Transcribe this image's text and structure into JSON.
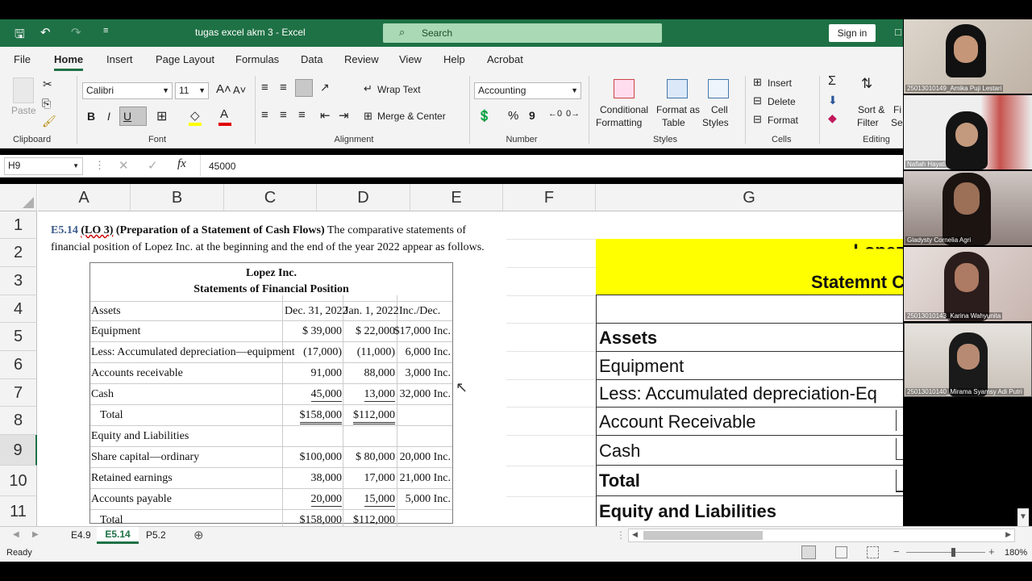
{
  "titlebar": {
    "filename": "tugas excel akm 3  -  Excel",
    "search_placeholder": "Search",
    "sign_in": "Sign in"
  },
  "menu": [
    "File",
    "Home",
    "Insert",
    "Page Layout",
    "Formulas",
    "Data",
    "Review",
    "View",
    "Help",
    "Acrobat"
  ],
  "ribbon": {
    "clipboard": {
      "paste": "Paste",
      "group": "Clipboard"
    },
    "font": {
      "name": "Calibri",
      "size": "11",
      "bold": "B",
      "italic": "I",
      "underline": "U",
      "group": "Font"
    },
    "alignment": {
      "wrap_text": "Wrap Text",
      "merge_center": "Merge & Center",
      "group": "Alignment"
    },
    "number": {
      "format": "Accounting",
      "percent": "%",
      "comma": "9",
      "group": "Number"
    },
    "styles": {
      "conditional": "Conditional",
      "formatting": "Formatting",
      "format_as": "Format as",
      "table": "Table",
      "cell": "Cell",
      "cell_styles": "Styles",
      "group": "Styles"
    },
    "cells": {
      "insert": "Insert",
      "delete": "Delete",
      "format": "Format",
      "group": "Cells"
    },
    "editing": {
      "sort": "Sort &",
      "filter": "Filter",
      "find": "Fi",
      "select": "Sel",
      "group": "Editing"
    }
  },
  "formula_bar": {
    "name_box": "H9",
    "fx": "fx",
    "value": "45000"
  },
  "columns": [
    "A",
    "B",
    "C",
    "D",
    "E",
    "F",
    "G"
  ],
  "rows": [
    "1",
    "2",
    "3",
    "4",
    "5",
    "6",
    "7",
    "8",
    "9",
    "10",
    "11"
  ],
  "image_text": {
    "heading_ref": "E5.14",
    "heading_lo": "(LO 3)",
    "heading_bold": "(Preparation of a Statement of Cash Flows)",
    "heading_rest": "The comparative statements of",
    "heading_line2": "financial position of Lopez Inc. at the beginning and the end of the year 2022 appear as follows."
  },
  "statement": {
    "company": "Lopez Inc.",
    "title": "Statements of Financial Position",
    "header": [
      "Assets",
      "Dec. 31, 2022",
      "Jan. 1, 2022",
      "Inc./Dec."
    ],
    "rows": [
      [
        "Equipment",
        "$ 39,000",
        "$ 22,000",
        "$17,000 Inc."
      ],
      [
        "Less: Accumulated depreciation—equipment",
        "(17,000)",
        "(11,000)",
        "6,000 Inc."
      ],
      [
        "Accounts receivable",
        "91,000",
        "88,000",
        "3,000 Inc."
      ],
      [
        "Cash",
        "45,000",
        "13,000",
        "32,000 Inc."
      ],
      [
        "   Total",
        "$158,000",
        "$112,000",
        ""
      ],
      [
        "Equity and Liabilities",
        "",
        "",
        ""
      ],
      [
        "Share capital—ordinary",
        "$100,000",
        "$ 80,000",
        "20,000 Inc."
      ],
      [
        "Retained earnings",
        "38,000",
        "17,000",
        "21,000 Inc."
      ],
      [
        "Accounts payable",
        "20,000",
        "15,000",
        "5,000 Inc."
      ],
      [
        "   Total",
        "$158,000",
        "$112,000",
        ""
      ]
    ]
  },
  "column_g": {
    "header_partial": "Lopez Inc",
    "statement_partial": "Statemnt C",
    "rows": [
      "Assets",
      "Equipment",
      "Less: Accumulated depreciation-Eq",
      "Account Receivable",
      "Cash",
      "Total",
      "Equity and Liabilities"
    ],
    "dollar": "$"
  },
  "sheets": {
    "tabs": [
      "E4.9",
      "E5.14",
      "P5.2"
    ],
    "active": "E5.14"
  },
  "status": {
    "ready": "Ready",
    "zoom": "180%"
  },
  "participants": [
    "25013010149_Amika Puji Lestari",
    "Nafiah Hayati",
    "Gladysty Cornelia Agri",
    "25013010143_Karina Wahyunita",
    "25013010140_Mirama Syamsy Adi Putri"
  ],
  "colors": {
    "excel_green": "#1e7145",
    "highlight_yellow": "#ffff00"
  }
}
